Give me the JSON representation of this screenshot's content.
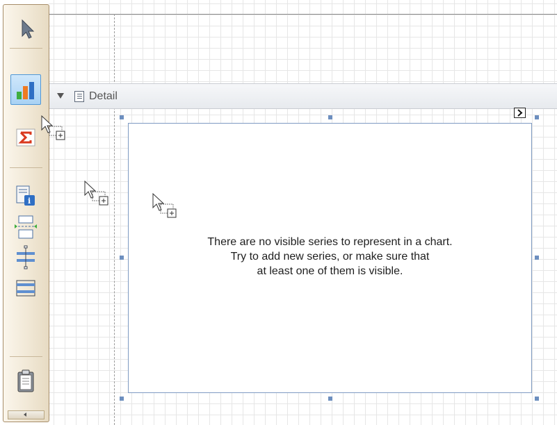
{
  "band": {
    "label": "Detail",
    "collapse_icon": "triangle-down-icon",
    "band_icon": "report-band-icon",
    "smart_tag_icon": "smart-tag-arrow-icon"
  },
  "chart": {
    "message_line1": "There are no visible series to represent in a chart.",
    "message_line2": "Try to add new series, or make sure that",
    "message_line3": "at least one of them is visible."
  },
  "toolbox": {
    "items": [
      {
        "name": "pointer",
        "icon": "arrow-pointer-icon"
      },
      {
        "name": "chart",
        "icon": "bar-chart-icon",
        "active": true
      },
      {
        "name": "summary",
        "icon": "sigma-icon"
      },
      {
        "name": "info",
        "icon": "page-info-icon"
      },
      {
        "name": "page-break",
        "icon": "page-break-icon"
      },
      {
        "name": "cross-band-line",
        "icon": "cross-band-line-icon"
      },
      {
        "name": "cross-band-box",
        "icon": "cross-band-box-icon"
      },
      {
        "name": "clipboard",
        "icon": "clipboard-icon"
      }
    ],
    "scroll_icon": "scroll-left-icon"
  },
  "colors": {
    "accent": "#4f97d6",
    "selection_handle": "#6d8fbf",
    "chart_border": "#7e9ac2",
    "toolbox_bg": "#f1e8d6",
    "sigma_red": "#d9381e"
  }
}
